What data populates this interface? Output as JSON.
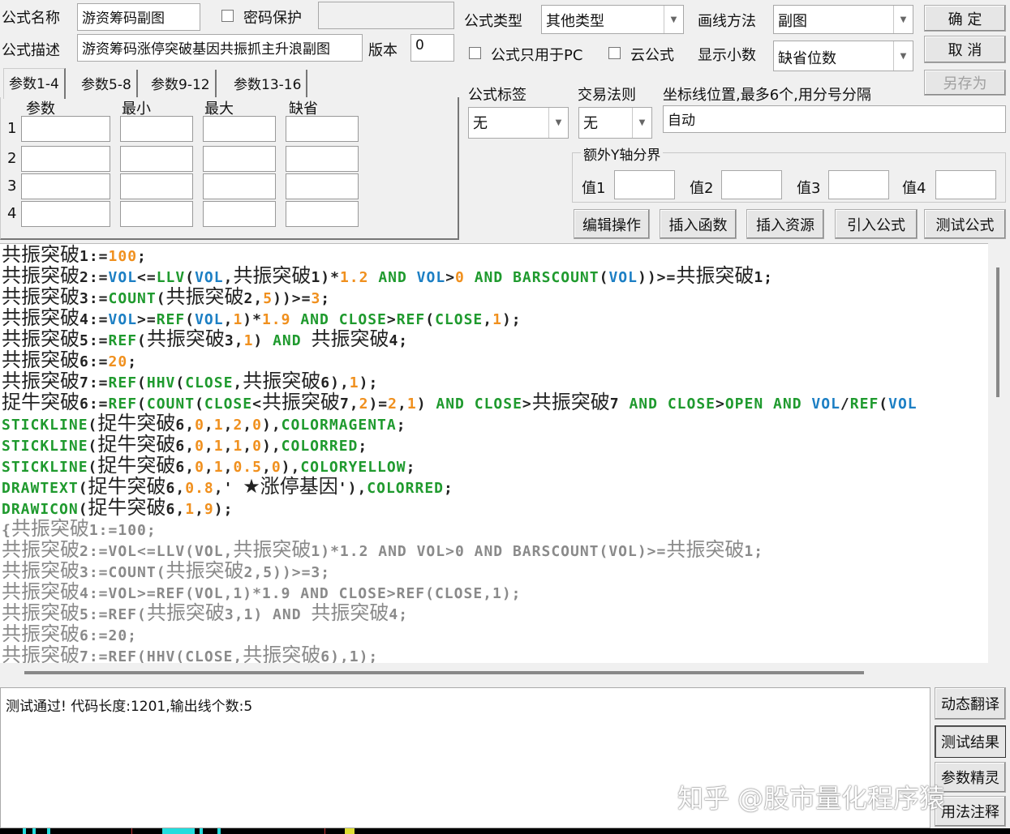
{
  "form": {
    "name_label": "公式名称",
    "name_value": "游资筹码副图",
    "password_label": "密码保护",
    "password_value": "",
    "desc_label": "公式描述",
    "desc_value": "游资筹码涨停突破基因共振抓主升浪副图",
    "version_label": "版本",
    "version_value": "0",
    "type_label": "公式类型",
    "type_value": "其他类型",
    "draw_label": "画线方法",
    "draw_value": "副图",
    "pc_only_label": "公式只用于PC",
    "cloud_label": "云公式",
    "decimal_label": "显示小数",
    "decimal_value": "缺省位数",
    "tag_label": "公式标签",
    "tag_value": "无",
    "rule_label": "交易法则",
    "rule_value": "无",
    "axis_label": "坐标线位置,最多6个,用分号分隔",
    "axis_value": "自动",
    "extra_group": "额外Y轴分界",
    "extra": [
      {
        "label": "值1",
        "value": ""
      },
      {
        "label": "值2",
        "value": ""
      },
      {
        "label": "值3",
        "value": ""
      },
      {
        "label": "值4",
        "value": ""
      }
    ]
  },
  "buttons": {
    "ok": "确  定",
    "cancel": "取  消",
    "save_as": "另存为",
    "edit": "编辑操作",
    "insert_func": "插入函数",
    "insert_res": "插入资源",
    "import": "引入公式",
    "test": "测试公式",
    "translate": "动态翻译",
    "result": "测试结果",
    "wizard": "参数精灵",
    "usage": "用法注释"
  },
  "params": {
    "tabs": [
      "参数1-4",
      "参数5-8",
      "参数9-12",
      "参数13-16"
    ],
    "headers": [
      "参数",
      "最小",
      "最大",
      "缺省"
    ],
    "rows": [
      "1",
      "2",
      "3",
      "4"
    ]
  },
  "code_lines": [
    {
      "comment": false,
      "tokens": [
        [
          "共振突破",
          "c"
        ],
        [
          "1:=",
          "n"
        ],
        [
          "100",
          "o"
        ],
        [
          ";",
          "n"
        ]
      ]
    },
    {
      "comment": false,
      "tokens": [
        [
          "共振突破",
          "c"
        ],
        [
          "2:=",
          "n"
        ],
        [
          "VOL",
          "v"
        ],
        [
          "<=",
          "n"
        ],
        [
          "LLV",
          "k"
        ],
        [
          "(",
          "n"
        ],
        [
          "VOL",
          "v"
        ],
        [
          ",",
          "n"
        ],
        [
          "共振突破",
          "c"
        ],
        [
          "1)*",
          "n"
        ],
        [
          "1.2",
          "o"
        ],
        [
          " ",
          "n"
        ],
        [
          "AND",
          "k"
        ],
        [
          " ",
          "n"
        ],
        [
          "VOL",
          "v"
        ],
        [
          ">",
          "n"
        ],
        [
          "0",
          "o"
        ],
        [
          " ",
          "n"
        ],
        [
          "AND",
          "k"
        ],
        [
          " ",
          "n"
        ],
        [
          "BARSCOUNT",
          "k"
        ],
        [
          "(",
          "n"
        ],
        [
          "VOL",
          "v"
        ],
        [
          "))>=",
          "n"
        ],
        [
          "共振突破",
          "c"
        ],
        [
          "1;",
          "n"
        ]
      ]
    },
    {
      "comment": false,
      "tokens": [
        [
          "共振突破",
          "c"
        ],
        [
          "3:=",
          "n"
        ],
        [
          "COUNT",
          "k"
        ],
        [
          "(",
          "n"
        ],
        [
          "共振突破",
          "c"
        ],
        [
          "2,",
          "n"
        ],
        [
          "5",
          "o"
        ],
        [
          "))>=",
          "n"
        ],
        [
          "3",
          "o"
        ],
        [
          ";",
          "n"
        ]
      ]
    },
    {
      "comment": false,
      "tokens": [
        [
          "共振突破",
          "c"
        ],
        [
          "4:=",
          "n"
        ],
        [
          "VOL",
          "v"
        ],
        [
          ">=",
          "n"
        ],
        [
          "REF",
          "k"
        ],
        [
          "(",
          "n"
        ],
        [
          "VOL",
          "v"
        ],
        [
          ",",
          "n"
        ],
        [
          "1",
          "o"
        ],
        [
          ")*",
          "n"
        ],
        [
          "1.9",
          "o"
        ],
        [
          " ",
          "n"
        ],
        [
          "AND",
          "k"
        ],
        [
          " ",
          "n"
        ],
        [
          "CLOSE",
          "k"
        ],
        [
          ">",
          "n"
        ],
        [
          "REF",
          "k"
        ],
        [
          "(",
          "n"
        ],
        [
          "CLOSE",
          "k"
        ],
        [
          ",",
          "n"
        ],
        [
          "1",
          "o"
        ],
        [
          ");",
          "n"
        ]
      ]
    },
    {
      "comment": false,
      "tokens": [
        [
          "共振突破",
          "c"
        ],
        [
          "5:=",
          "n"
        ],
        [
          "REF",
          "k"
        ],
        [
          "(",
          "n"
        ],
        [
          "共振突破",
          "c"
        ],
        [
          "3,",
          "n"
        ],
        [
          "1",
          "o"
        ],
        [
          ") ",
          "n"
        ],
        [
          "AND",
          "k"
        ],
        [
          " ",
          "n"
        ],
        [
          "共振突破",
          "c"
        ],
        [
          "4;",
          "n"
        ]
      ]
    },
    {
      "comment": false,
      "tokens": [
        [
          "共振突破",
          "c"
        ],
        [
          "6:=",
          "n"
        ],
        [
          "20",
          "o"
        ],
        [
          ";",
          "n"
        ]
      ]
    },
    {
      "comment": false,
      "tokens": [
        [
          "共振突破",
          "c"
        ],
        [
          "7:=",
          "n"
        ],
        [
          "REF",
          "k"
        ],
        [
          "(",
          "n"
        ],
        [
          "HHV",
          "k"
        ],
        [
          "(",
          "n"
        ],
        [
          "CLOSE",
          "k"
        ],
        [
          ",",
          "n"
        ],
        [
          "共振突破",
          "c"
        ],
        [
          "6),",
          "n"
        ],
        [
          "1",
          "o"
        ],
        [
          ");",
          "n"
        ]
      ]
    },
    {
      "comment": false,
      "tokens": [
        [
          "捉牛突破",
          "c"
        ],
        [
          "6:=",
          "n"
        ],
        [
          "REF",
          "k"
        ],
        [
          "(",
          "n"
        ],
        [
          "COUNT",
          "k"
        ],
        [
          "(",
          "n"
        ],
        [
          "CLOSE",
          "k"
        ],
        [
          "<",
          "n"
        ],
        [
          "共振突破",
          "c"
        ],
        [
          "7,",
          "n"
        ],
        [
          "2",
          "o"
        ],
        [
          ")=",
          "n"
        ],
        [
          "2",
          "o"
        ],
        [
          ",",
          "n"
        ],
        [
          "1",
          "o"
        ],
        [
          ") ",
          "n"
        ],
        [
          "AND",
          "k"
        ],
        [
          " ",
          "n"
        ],
        [
          "CLOSE",
          "k"
        ],
        [
          ">",
          "n"
        ],
        [
          "共振突破",
          "c"
        ],
        [
          "7 ",
          "n"
        ],
        [
          "AND",
          "k"
        ],
        [
          " ",
          "n"
        ],
        [
          "CLOSE",
          "k"
        ],
        [
          ">",
          "n"
        ],
        [
          "OPEN",
          "k"
        ],
        [
          " ",
          "n"
        ],
        [
          "AND",
          "k"
        ],
        [
          " ",
          "n"
        ],
        [
          "VOL",
          "v"
        ],
        [
          "/",
          "n"
        ],
        [
          "REF",
          "k"
        ],
        [
          "(",
          "n"
        ],
        [
          "VOL",
          "v"
        ]
      ]
    },
    {
      "comment": false,
      "tokens": [
        [
          "STICKLINE",
          "k"
        ],
        [
          "(",
          "n"
        ],
        [
          "捉牛突破",
          "c"
        ],
        [
          "6,",
          "n"
        ],
        [
          "0",
          "o"
        ],
        [
          ",",
          "n"
        ],
        [
          "1",
          "o"
        ],
        [
          ",",
          "n"
        ],
        [
          "2",
          "o"
        ],
        [
          ",",
          "n"
        ],
        [
          "0",
          "o"
        ],
        [
          "),",
          "n"
        ],
        [
          "COLORMAGENTA",
          "k"
        ],
        [
          ";",
          "n"
        ]
      ]
    },
    {
      "comment": false,
      "tokens": [
        [
          "STICKLINE",
          "k"
        ],
        [
          "(",
          "n"
        ],
        [
          "捉牛突破",
          "c"
        ],
        [
          "6,",
          "n"
        ],
        [
          "0",
          "o"
        ],
        [
          ",",
          "n"
        ],
        [
          "1",
          "o"
        ],
        [
          ",",
          "n"
        ],
        [
          "1",
          "o"
        ],
        [
          ",",
          "n"
        ],
        [
          "0",
          "o"
        ],
        [
          "),",
          "n"
        ],
        [
          "COLORRED",
          "k"
        ],
        [
          ";",
          "n"
        ]
      ]
    },
    {
      "comment": false,
      "tokens": [
        [
          "STICKLINE",
          "k"
        ],
        [
          "(",
          "n"
        ],
        [
          "捉牛突破",
          "c"
        ],
        [
          "6,",
          "n"
        ],
        [
          "0",
          "o"
        ],
        [
          ",",
          "n"
        ],
        [
          "1",
          "o"
        ],
        [
          ",",
          "n"
        ],
        [
          "0.5",
          "o"
        ],
        [
          ",",
          "n"
        ],
        [
          "0",
          "o"
        ],
        [
          "),",
          "n"
        ],
        [
          "COLORYELLOW",
          "k"
        ],
        [
          ";",
          "n"
        ]
      ]
    },
    {
      "comment": false,
      "tokens": [
        [
          "DRAWTEXT",
          "k"
        ],
        [
          "(",
          "n"
        ],
        [
          "捉牛突破",
          "c"
        ],
        [
          "6,",
          "n"
        ],
        [
          "0.8",
          "o"
        ],
        [
          ",' ",
          "n"
        ],
        [
          "★涨停基因",
          "c"
        ],
        [
          "'),",
          "n"
        ],
        [
          "COLORRED",
          "k"
        ],
        [
          ";",
          "n"
        ]
      ]
    },
    {
      "comment": false,
      "tokens": [
        [
          "DRAWICON",
          "k"
        ],
        [
          "(",
          "n"
        ],
        [
          "捉牛突破",
          "c"
        ],
        [
          "6,",
          "n"
        ],
        [
          "1",
          "o"
        ],
        [
          ",",
          "n"
        ],
        [
          "9",
          "o"
        ],
        [
          ");",
          "n"
        ]
      ]
    },
    {
      "comment": true,
      "tokens": [
        [
          "{",
          "n"
        ],
        [
          "共振突破",
          "c"
        ],
        [
          "1:=100;",
          "n"
        ]
      ]
    },
    {
      "comment": true,
      "tokens": [
        [
          "共振突破",
          "c"
        ],
        [
          "2:=VOL<=LLV(VOL,",
          "n"
        ],
        [
          "共振突破",
          "c"
        ],
        [
          "1)*1.2 AND VOL>0 AND BARSCOUNT(VOL)>=",
          "n"
        ],
        [
          "共振突破",
          "c"
        ],
        [
          "1;",
          "n"
        ]
      ]
    },
    {
      "comment": true,
      "tokens": [
        [
          "共振突破",
          "c"
        ],
        [
          "3:=COUNT(",
          "n"
        ],
        [
          "共振突破",
          "c"
        ],
        [
          "2,5))>=3;",
          "n"
        ]
      ]
    },
    {
      "comment": true,
      "tokens": [
        [
          "共振突破",
          "c"
        ],
        [
          "4:=VOL>=REF(VOL,1)*1.9 AND CLOSE>REF(CLOSE,1);",
          "n"
        ]
      ]
    },
    {
      "comment": true,
      "tokens": [
        [
          "共振突破",
          "c"
        ],
        [
          "5:=REF(",
          "n"
        ],
        [
          "共振突破",
          "c"
        ],
        [
          "3,1) AND ",
          "n"
        ],
        [
          "共振突破",
          "c"
        ],
        [
          "4;",
          "n"
        ]
      ]
    },
    {
      "comment": true,
      "tokens": [
        [
          "共振突破",
          "c"
        ],
        [
          "6:=20;",
          "n"
        ]
      ]
    },
    {
      "comment": true,
      "tokens": [
        [
          "共振突破",
          "c"
        ],
        [
          "7:=REF(HHV(CLOSE,",
          "n"
        ],
        [
          "共振突破",
          "c"
        ],
        [
          "6),1);",
          "n"
        ]
      ]
    }
  ],
  "output": {
    "message": "测试通过! 代码长度:1201,输出线个数:5"
  },
  "watermark": "知乎 @股市量化程序猿",
  "colors": {
    "keyword": "#1f9a2e",
    "variable": "#1c7fc4",
    "number": "#f0901e",
    "comment": "#8a8a8a"
  }
}
